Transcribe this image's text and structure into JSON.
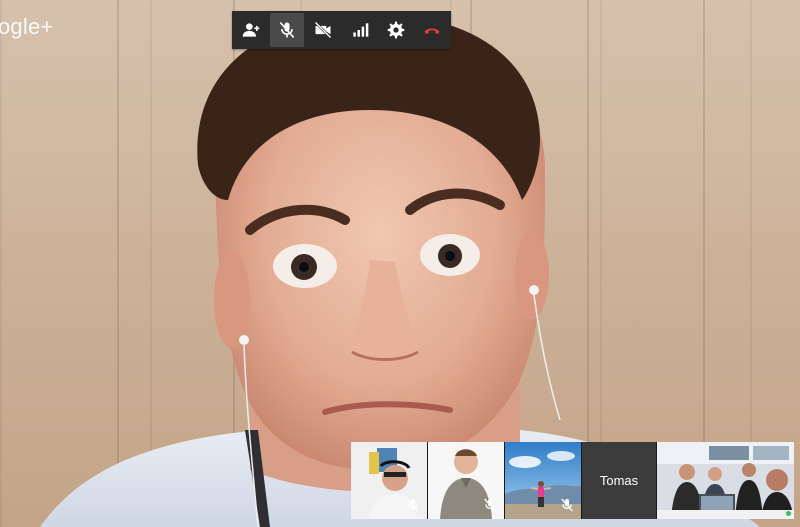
{
  "brand_text": "ogle+",
  "toolbar": {
    "buttons": [
      {
        "icon": "add-person-icon"
      },
      {
        "icon": "mic-muted-icon",
        "active": true
      },
      {
        "icon": "camera-off-icon"
      },
      {
        "icon": "signal-bars-icon"
      },
      {
        "icon": "gear-icon"
      },
      {
        "icon": "hang-up-icon",
        "accent": "#e0403a"
      }
    ]
  },
  "filmstrip": {
    "participants": [
      {
        "type": "video",
        "muted": true
      },
      {
        "type": "video",
        "muted": true
      },
      {
        "type": "video",
        "muted": true
      },
      {
        "type": "name",
        "name": "Tomas"
      },
      {
        "type": "video",
        "active_speaker": true
      }
    ]
  }
}
